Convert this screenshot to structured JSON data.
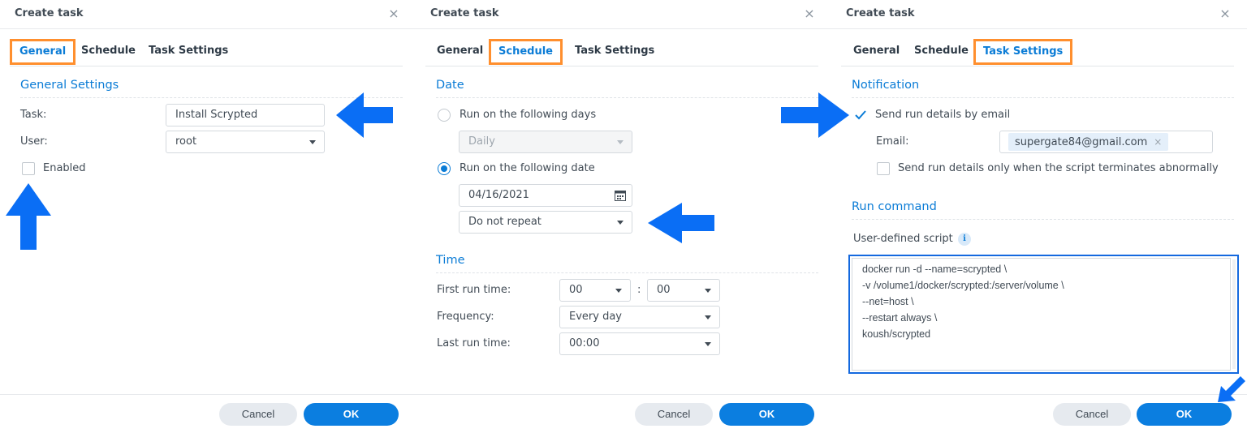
{
  "colors": {
    "accent": "#0b7cd6",
    "tab_highlight": "#ff8f2e",
    "arrow": "#0a6ef5",
    "ok_button": "#0b7ee0"
  },
  "icons": {
    "close": "close-icon",
    "caret": "chevron-down-icon",
    "calendar": "calendar-icon",
    "info": "info-icon",
    "arrow": "arrow-annotation-icon"
  },
  "common": {
    "dialog_title": "Create task",
    "close_glyph": "×",
    "tab_general": "General",
    "tab_schedule": "Schedule",
    "tab_task_settings": "Task Settings",
    "cancel": "Cancel",
    "ok": "OK"
  },
  "general": {
    "section_title": "General Settings",
    "task_label": "Task:",
    "task_value": "Install Scrypted",
    "user_label": "User:",
    "user_value": "root",
    "enabled_label": "Enabled",
    "enabled_checked": false
  },
  "schedule": {
    "date_section": "Date",
    "run_days_label": "Run on the following days",
    "days_value": "Daily",
    "run_date_label": "Run on the following date",
    "date_value": "04/16/2021",
    "repeat_value": "Do not repeat",
    "time_section": "Time",
    "first_run_label": "First run time:",
    "first_hour": "00",
    "time_sep": ":",
    "first_minute": "00",
    "frequency_label": "Frequency:",
    "frequency_value": "Every day",
    "last_run_label": "Last run time:",
    "last_run_value": "00:00"
  },
  "task_settings": {
    "notification_section": "Notification",
    "send_email_label": "Send run details by email",
    "send_email_checked": true,
    "email_label": "Email:",
    "email_value": "supergate84@gmail.com",
    "email_remove": "×",
    "abnormal_label": "Send run details only when the script terminates abnormally",
    "run_command_section": "Run command",
    "script_label": "User-defined script",
    "info_glyph": "i",
    "script_lines": [
      "docker run -d --name=scrypted \\",
      "-v /volume1/docker/scrypted:/server/volume \\",
      "--net=host \\",
      "--restart always \\",
      "koush/scrypted"
    ]
  }
}
